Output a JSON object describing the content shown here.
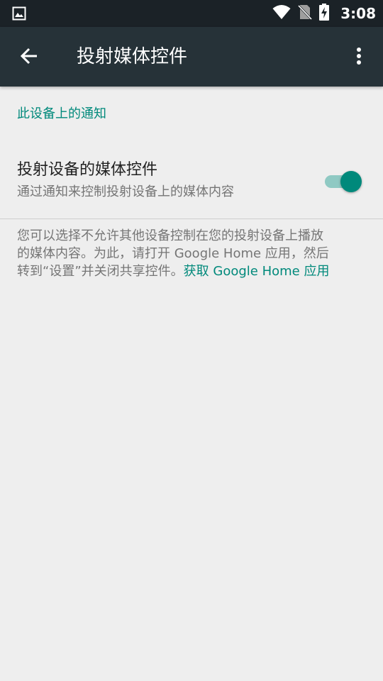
{
  "status_bar": {
    "time": "3:08",
    "icons": [
      "image-notification-icon",
      "wifi-icon",
      "no-sim-icon",
      "battery-charging-icon"
    ]
  },
  "app_bar": {
    "title": "投射媒体控件",
    "icons": [
      "back-arrow-icon",
      "more-vert-icon"
    ]
  },
  "section": {
    "header": "此设备上的通知"
  },
  "setting": {
    "title": "投射设备的媒体控件",
    "summary": "通过通知来控制投射设备上的媒体内容",
    "enabled": true
  },
  "footer": {
    "line1": "您可以选择不允许其他设备控制在您的投射设备上播放",
    "line2": "的媒体内容。为此，请打开 Google Home 应用，然后",
    "line3_text": "转到“设置”并关闭共享控件。",
    "line3_link": "获取 Google Home 应用"
  },
  "colors": {
    "accent": "#00897b",
    "app_bar": "#263238",
    "status_bar": "#1b2227",
    "background": "#eeeeee"
  }
}
